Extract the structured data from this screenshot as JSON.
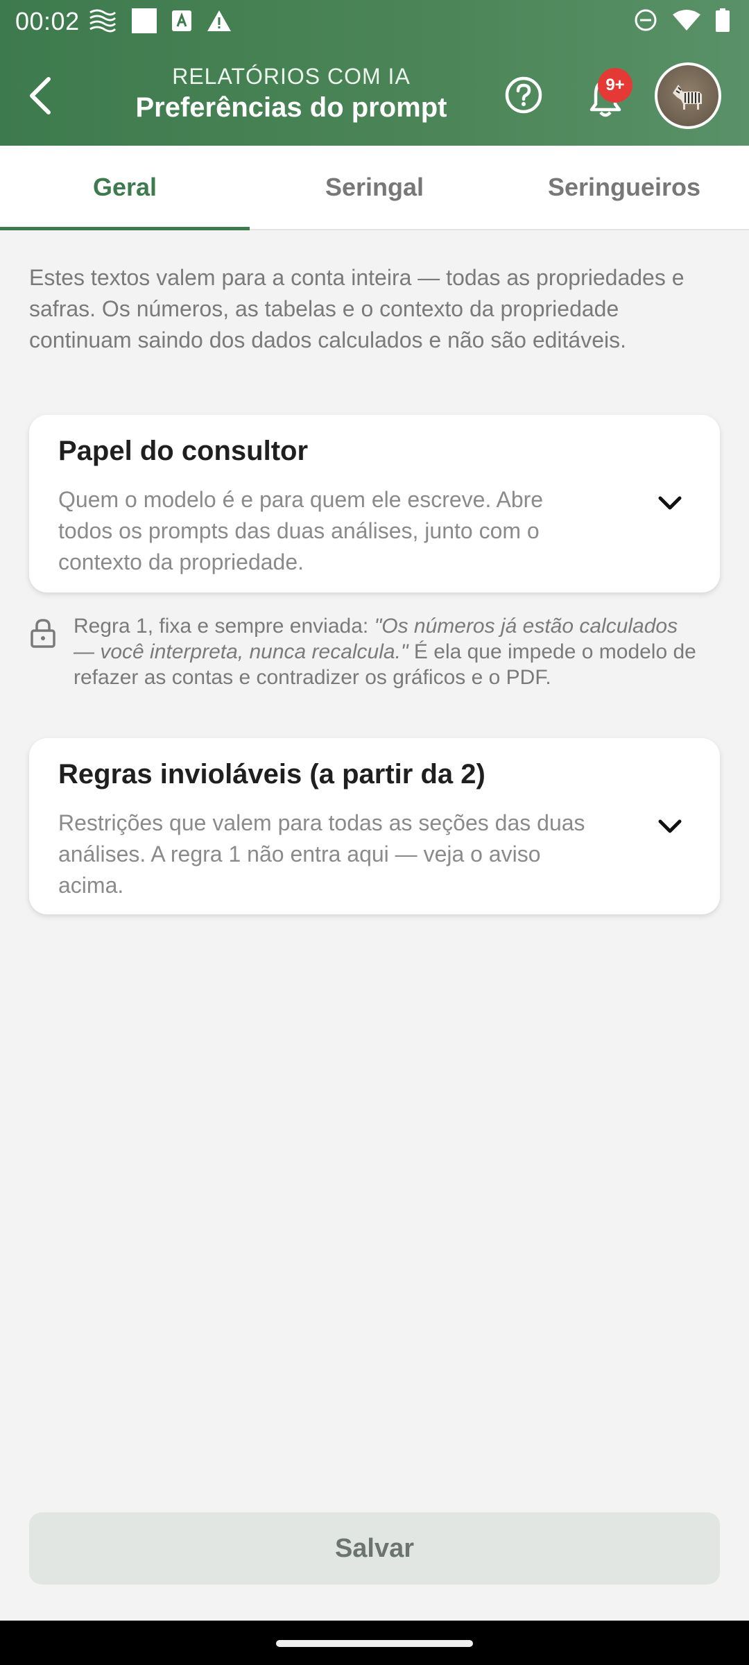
{
  "status_bar": {
    "time": "00:02",
    "left_icons": [
      "weather-icon",
      "square-icon",
      "a-icon",
      "warning-icon"
    ],
    "right_icons": [
      "dnd-icon",
      "wifi-icon",
      "battery-icon"
    ]
  },
  "app_bar": {
    "subtitle": "RELATÓRIOS COM IA",
    "title": "Preferências do prompt",
    "notification_badge": "9+"
  },
  "tabs": [
    {
      "label": "Geral",
      "active": true
    },
    {
      "label": "Seringal",
      "active": false
    },
    {
      "label": "Seringueiros",
      "active": false
    }
  ],
  "intro_text": "Estes textos valem para a conta inteira — todas as propriedades e safras. Os números, as tabelas e o contexto da propriedade continuam saindo dos dados calculados e não são editáveis.",
  "cards": [
    {
      "title": "Papel do consultor",
      "description": "Quem o modelo é e para quem ele escreve. Abre todos os prompts das duas análises, junto com o contexto da propriedade."
    },
    {
      "title": "Regras invioláveis (a partir da 2)",
      "description": "Restrições que valem para todas as seções das duas análises. A regra 1 não entra aqui — veja o aviso acima."
    }
  ],
  "lock_note": {
    "prefix": "Regra 1, fixa e sempre enviada: ",
    "quote": "\"Os números já estão calculados — você interpreta, nunca recalcula.\"",
    "suffix": " É ela que impede o modelo de refazer as contas e contradizer os gráficos e o PDF."
  },
  "save_label": "Salvar",
  "colors": {
    "primary": "#3d7a4d",
    "badge": "#e53935",
    "background": "#f3f3f3"
  }
}
